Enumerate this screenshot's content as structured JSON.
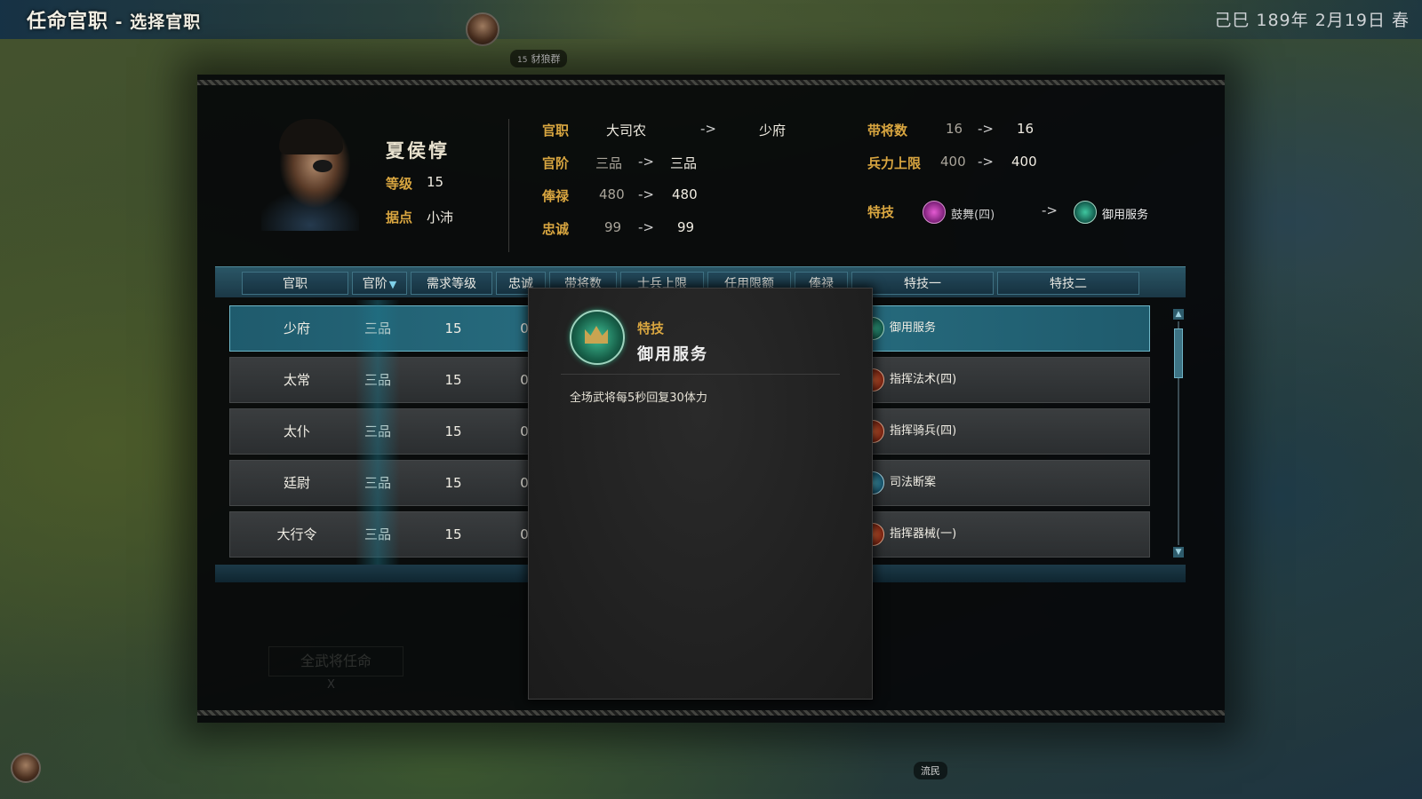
{
  "header": {
    "title": "任命官职",
    "separator": " - ",
    "subtitle": "选择官职",
    "date": "己巳 189年 2月19日 春"
  },
  "map": {
    "unit_tag": "豺狼群",
    "unit_level": "15",
    "refugee_tag": "流民"
  },
  "officer": {
    "name": "夏侯惇",
    "level_label": "等级",
    "level": "15",
    "base_label": "据点",
    "base": "小沛"
  },
  "changes": {
    "arrow": "->",
    "post": {
      "label": "官职",
      "from": "大司农",
      "to": "少府"
    },
    "rank": {
      "label": "官阶",
      "from": "三品",
      "to": "三品"
    },
    "salary": {
      "label": "俸禄",
      "from": "480",
      "to": "480"
    },
    "loyalty": {
      "label": "忠诚",
      "from": "99",
      "to": "99"
    },
    "commanders": {
      "label": "带将数",
      "from": "16",
      "to": "16"
    },
    "troops": {
      "label": "兵力上限",
      "from": "400",
      "to": "400"
    },
    "skill": {
      "label": "特技",
      "from": "鼓舞(四)",
      "to": "御用服务"
    }
  },
  "table": {
    "headers": [
      "官职",
      "官阶",
      "需求等级",
      "忠诚",
      "带将数",
      "士兵上限",
      "任用限额",
      "俸禄",
      "特技一",
      "特技二"
    ],
    "rows": [
      {
        "post": "少府",
        "rank": "三品",
        "req_level": "15",
        "loyalty": "0",
        "skill1": "御用服务",
        "skill1_color": "green",
        "selected": true
      },
      {
        "post": "太常",
        "rank": "三品",
        "req_level": "15",
        "loyalty": "0",
        "skill1": "指挥法术(四)",
        "skill1_color": "red",
        "selected": false
      },
      {
        "post": "太仆",
        "rank": "三品",
        "req_level": "15",
        "loyalty": "0",
        "skill1": "指挥骑兵(四)",
        "skill1_color": "red",
        "selected": false
      },
      {
        "post": "廷尉",
        "rank": "三品",
        "req_level": "15",
        "loyalty": "0",
        "skill1": "司法断案",
        "skill1_color": "teal",
        "selected": false
      },
      {
        "post": "大行令",
        "rank": "三品",
        "req_level": "15",
        "loyalty": "0",
        "skill1": "指挥器械(一)",
        "skill1_color": "red",
        "selected": false
      }
    ]
  },
  "tooltip": {
    "label": "特技",
    "name": "御用服务",
    "description": "全场武将每5秒回复30体力"
  },
  "footer": {
    "appoint_all": "全武将任命",
    "close_hint": "X"
  },
  "colors": {
    "gold_label": "#d9a640",
    "selected_row": "#2a7285",
    "header_bar": "#23485a"
  }
}
